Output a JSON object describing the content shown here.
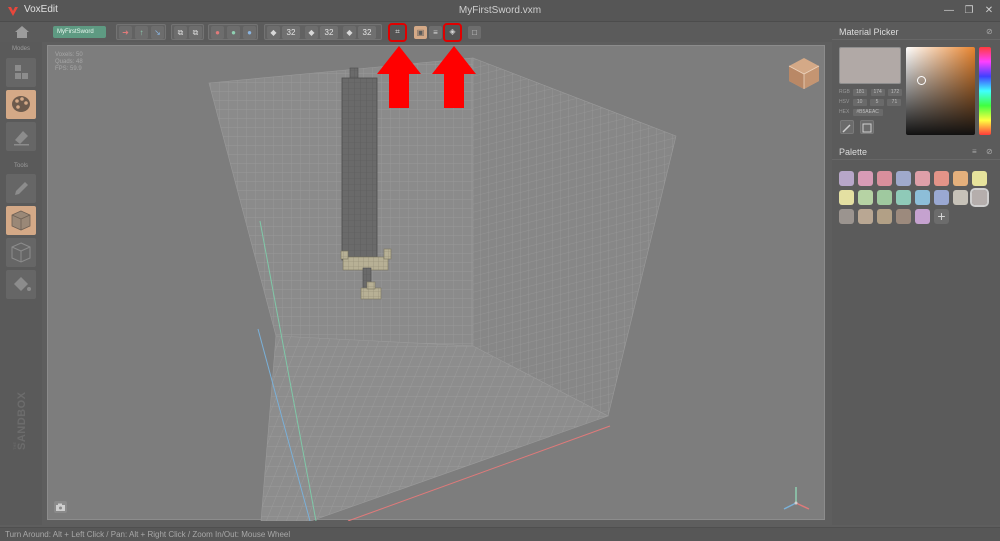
{
  "app": {
    "name": "VoxEdit",
    "file_name": "MyFirstSword.vxm",
    "window_controls": {
      "minimize": "—",
      "maximize": "❐",
      "close": "✕"
    }
  },
  "toolbar": {
    "model_badge": "MyFirstSword",
    "dim_x": "32",
    "dim_y": "32",
    "dim_z": "32",
    "icons": [
      "home-icon",
      "move-icon",
      "rotate-icon",
      "scale-icon",
      "mirror-icon",
      "sphere-icon",
      "crop-icon",
      "cube-icon",
      "layers-icon",
      "export-icon"
    ]
  },
  "left_panel": {
    "modes_heading": "Modes",
    "tools_heading": "Tools",
    "mode_items": [
      "select-mode",
      "paint-mode",
      "erase-mode"
    ],
    "tool_items": [
      "pencil-tool",
      "voxel-box-tool",
      "wireframe-tool",
      "fill-tool"
    ],
    "logo_text": "THE SANDBOX"
  },
  "viewport": {
    "stats": {
      "voxels": "Voxels: 50",
      "quads": "Quads: 48",
      "fps": "FPS: 59.9"
    }
  },
  "material_picker": {
    "title": "Material Picker",
    "preview_color": "#b1a9a6",
    "rgb_label": "RGB",
    "rgb_values": [
      "181",
      "174",
      "172"
    ],
    "hsv_label": "HSV",
    "hsv_values": [
      "10",
      "5",
      "71"
    ],
    "hex_label": "HEX",
    "hex_value": "#B5AEAC"
  },
  "palette": {
    "title": "Palette",
    "add_label": "+",
    "selected_index": 15,
    "colors": [
      "#b7a6c9",
      "#d89bb6",
      "#d98f9c",
      "#9fa9cc",
      "#de9fa8",
      "#e49488",
      "#e4b07c",
      "#e6e39c",
      "#e4e0a2",
      "#b6d3a4",
      "#9fc99f",
      "#8fcab8",
      "#8dbed8",
      "#9aa8d2",
      "#c7c2b8",
      "#b5aeac",
      "#9b948f",
      "#b9a793",
      "#b2a086",
      "#9c8a7d",
      "#c5a2cf"
    ]
  },
  "status_bar": {
    "text": "Turn Around: Alt + Left Click / Pan: Alt + Right Click / Zoom In/Out: Mouse Wheel"
  },
  "colors": {
    "accent_paint": "#d4a987",
    "badge_green": "#5e9a82",
    "highlight_red": "#e00000",
    "viewport_bg": "#7d7d7d",
    "grid_line": "#8f8f8f"
  }
}
